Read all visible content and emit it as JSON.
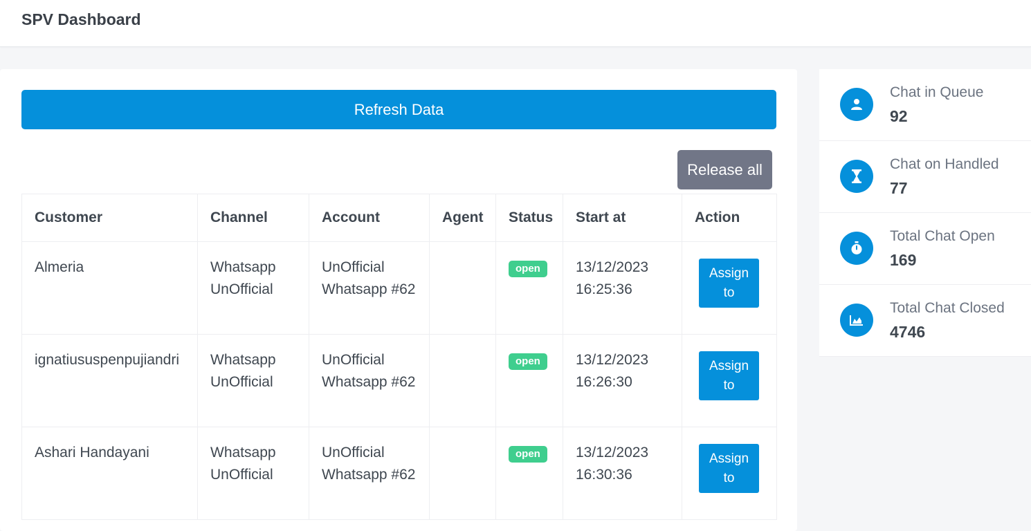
{
  "header": {
    "title": "SPV Dashboard"
  },
  "actions": {
    "refresh_label": "Refresh Data",
    "release_label": "Release all"
  },
  "table": {
    "columns": [
      "Customer",
      "Channel",
      "Account",
      "Agent",
      "Status",
      "Start at",
      "Action"
    ],
    "rows": [
      {
        "customer": "Almeria",
        "channel": "Whatsapp UnOfficial",
        "account": "UnOfficial Whatsapp #62",
        "agent": "",
        "status": "open",
        "start_at": "13/12/2023 16:25:36",
        "action": "Assign to"
      },
      {
        "customer": "ignatiususpenpujiandri",
        "channel": "Whatsapp UnOfficial",
        "account": "UnOfficial Whatsapp #62",
        "agent": "",
        "status": "open",
        "start_at": "13/12/2023 16:26:30",
        "action": "Assign to"
      },
      {
        "customer": "Ashari Handayani",
        "channel": "Whatsapp UnOfficial",
        "account": "UnOfficial Whatsapp #62",
        "agent": "",
        "status": "open",
        "start_at": "13/12/2023 16:30:36",
        "action": "Assign to"
      }
    ]
  },
  "stats": [
    {
      "label": "Chat in Queue",
      "value": "92",
      "icon": "user-icon"
    },
    {
      "label": "Chat on Handled",
      "value": "77",
      "icon": "hourglass-icon"
    },
    {
      "label": "Total Chat Open",
      "value": "169",
      "icon": "stopwatch-icon"
    },
    {
      "label": "Total Chat Closed",
      "value": "4746",
      "icon": "area-chart-icon"
    }
  ],
  "colors": {
    "primary": "#0590db",
    "secondary": "#717687",
    "success": "#3fce8e",
    "background": "#f5f6f8"
  }
}
